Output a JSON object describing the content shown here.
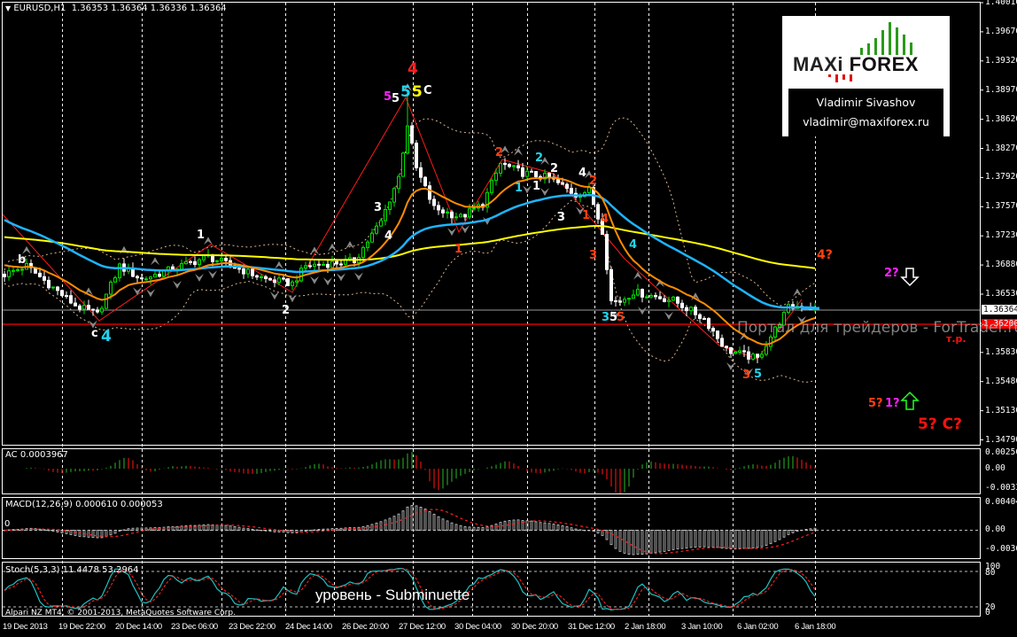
{
  "header": {
    "menu_icon": "triangle-down-icon",
    "symbol": "EURUSD,H1",
    "ohlc": "1.36353 1.36364 1.36336 1.36364"
  },
  "colors": {
    "bull": "#00e000",
    "bear": "#ffffff",
    "ma_fast": "#ff8c00",
    "ma_mid": "#1eb4ff",
    "ma_slow": "#ffff00",
    "zigzag": "#ff1a1a",
    "bid_line": "#9a9a9a",
    "level_line": "#ff0000",
    "stoch_main": "#20c0c0",
    "signal": "#ff2020"
  },
  "price_axis": [
    "1.40010",
    "1.39670",
    "1.39320",
    "1.38970",
    "1.38620",
    "1.38270",
    "1.37920",
    "1.37570",
    "1.37230",
    "1.36880",
    "1.36530",
    "1.36180",
    "1.35830",
    "1.35480",
    "1.35130",
    "1.34790"
  ],
  "price_tags": {
    "bid": "1.36364",
    "level": "1.36200"
  },
  "indicators": {
    "ac": {
      "title": "AC 0.0003967",
      "axis": [
        "0.002566",
        "0.00",
        "-0.003395"
      ]
    },
    "macd": {
      "title": "MACD(12,26,9) 0.000610 0.000053",
      "zero_label": "0",
      "axis": [
        "0.004045",
        "0.00",
        "-0.003638"
      ]
    },
    "stoch": {
      "title": "Stoch(5,3,3) 11.4478 53.2964",
      "axis": [
        "100",
        "80",
        "20",
        "0"
      ]
    }
  },
  "time_axis": [
    "19 Dec 2013",
    "19 Dec 22:00",
    "20 Dec 14:00",
    "23 Dec 06:00",
    "23 Dec 22:00",
    "24 Dec 14:00",
    "26 Dec 20:00",
    "27 Dec 12:00",
    "30 Dec 04:00",
    "30 Dec 20:00",
    "31 Dec 12:00",
    "2 Jan 18:00",
    "3 Jan 10:00",
    "6 Jan 02:00",
    "6 Jan 18:00"
  ],
  "chart_data": {
    "type": "candlestick",
    "symbol": "EURUSD",
    "timeframe": "H1",
    "ylim": [
      1.3479,
      1.4001
    ],
    "close_keypoints": [
      [
        0,
        1.3677
      ],
      [
        5,
        1.3687
      ],
      [
        11,
        1.3661
      ],
      [
        16,
        1.364
      ],
      [
        21,
        1.3629
      ],
      [
        26,
        1.3687
      ],
      [
        31,
        1.3671
      ],
      [
        46,
        1.3698
      ],
      [
        59,
        1.3671
      ],
      [
        65,
        1.3666
      ],
      [
        68,
        1.3687
      ],
      [
        79,
        1.3693
      ],
      [
        85,
        1.374
      ],
      [
        89,
        1.3793
      ],
      [
        91,
        1.3856
      ],
      [
        93,
        1.3803
      ],
      [
        97,
        1.3756
      ],
      [
        103,
        1.3745
      ],
      [
        108,
        1.3761
      ],
      [
        112,
        1.3809
      ],
      [
        117,
        1.3798
      ],
      [
        123,
        1.3792
      ],
      [
        129,
        1.3772
      ],
      [
        132,
        1.3777
      ],
      [
        135,
        1.3729
      ],
      [
        137,
        1.3645
      ],
      [
        139,
        1.3645
      ],
      [
        142,
        1.3656
      ],
      [
        151,
        1.3646
      ],
      [
        158,
        1.3624
      ],
      [
        163,
        1.3587
      ],
      [
        170,
        1.3576
      ],
      [
        173,
        1.3603
      ],
      [
        177,
        1.3637
      ],
      [
        180,
        1.364
      ],
      [
        183,
        1.3636
      ]
    ],
    "high_extreme": 1.389,
    "low_extreme": 1.3571,
    "level_line": 1.362,
    "bid": 1.36364
  },
  "logo": {
    "brand_left": "MAXi",
    "brand_right": "FOREX",
    "name": "Vladimir Sivashov",
    "email": "vladimir@maxiforex.ru"
  },
  "wave_labels": [
    {
      "t": "b",
      "c": "#ffffff"
    },
    {
      "t": "c",
      "c": "#ffffff"
    },
    {
      "t": "4",
      "c": "#22d3ee"
    },
    {
      "t": "1",
      "c": "#ffffff"
    },
    {
      "t": "2",
      "c": "#ffffff"
    },
    {
      "t": "4",
      "c": "#ff2020"
    },
    {
      "t": "5",
      "c": "#ff22ff"
    },
    {
      "t": "5",
      "c": "#ffffff"
    },
    {
      "t": "5",
      "c": "#22d3ee"
    },
    {
      "t": "5",
      "c": "#ffff00"
    },
    {
      "t": "C",
      "c": "#ffffff"
    },
    {
      "t": "3",
      "c": "#ffffff"
    },
    {
      "t": "4",
      "c": "#ffffff"
    },
    {
      "t": "1",
      "c": "#ff4010"
    },
    {
      "t": "2",
      "c": "#ff4010"
    },
    {
      "t": "1",
      "c": "#22d3ee"
    },
    {
      "t": "2",
      "c": "#22d3ee"
    },
    {
      "t": "2",
      "c": "#ffffff"
    },
    {
      "t": "1",
      "c": "#ffffff"
    },
    {
      "t": "3",
      "c": "#ffffff"
    },
    {
      "t": "4",
      "c": "#ffffff"
    },
    {
      "t": "2",
      "c": "#ff4010"
    },
    {
      "t": "1",
      "c": "#ff4010"
    },
    {
      "t": "4",
      "c": "#ff4010"
    },
    {
      "t": "3",
      "c": "#ff4010"
    },
    {
      "t": "4",
      "c": "#22d3ee"
    },
    {
      "t": "3",
      "c": "#22d3ee"
    },
    {
      "t": "5",
      "c": "#ffffff"
    },
    {
      "t": "5",
      "c": "#ff4010"
    },
    {
      "t": "3",
      "c": "#ff4010"
    },
    {
      "t": "5",
      "c": "#22d3ee"
    }
  ],
  "forecast": {
    "wave4": "4?",
    "wave2": "2?",
    "wave5": "5?",
    "wave1": "1?",
    "final": "5? C?",
    "target": "т.р.",
    "down_arrow": "arrow-down-icon",
    "up_arrow": "arrow-up-icon"
  },
  "watermark": "Портал для трейдеров - ForTrader.ru",
  "level_caption": "уровень - Subminuette",
  "copyright": "Alpari NZ MT4, © 2001-2013, MetaQuotes Software Corp."
}
